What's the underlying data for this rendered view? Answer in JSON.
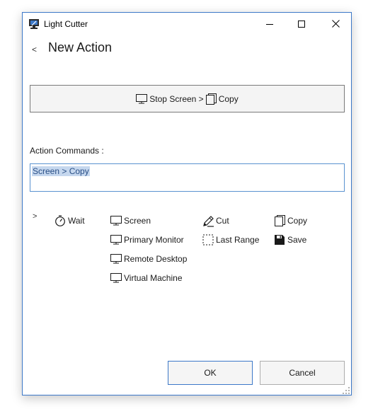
{
  "window": {
    "title": "Light Cutter",
    "controls": {
      "minimize_icon": "minimize-icon",
      "maximize_icon": "maximize-icon",
      "close_icon": "close-icon"
    }
  },
  "page": {
    "back_glyph": "<",
    "heading": "New Action"
  },
  "preview": {
    "segments": [
      {
        "icon": "monitor-icon",
        "text": "Stop Screen >"
      },
      {
        "icon": "copy-icon",
        "text": "Copy"
      }
    ]
  },
  "commands_field": {
    "label": "Action Commands :",
    "value": "Screen > Copy"
  },
  "palette": {
    "toggle_glyph": ">",
    "items": {
      "wait": {
        "icon": "stopwatch-icon",
        "label": "Wait"
      },
      "screen": {
        "icon": "monitor-icon",
        "label": "Screen"
      },
      "primary_monitor": {
        "icon": "monitor-icon",
        "label": "Primary Monitor"
      },
      "remote_desktop": {
        "icon": "monitor-icon",
        "label": "Remote Desktop"
      },
      "virtual_machine": {
        "icon": "monitor-icon",
        "label": "Virtual Machine"
      },
      "cut": {
        "icon": "pen-icon",
        "label": "Cut"
      },
      "last_range": {
        "icon": "dashed-selection-icon",
        "label": "Last Range"
      },
      "copy": {
        "icon": "copy-icon",
        "label": "Copy"
      },
      "save": {
        "icon": "floppy-disk-icon",
        "label": "Save"
      }
    }
  },
  "buttons": {
    "ok": "OK",
    "cancel": "Cancel"
  },
  "colors": {
    "window_border": "#3c78c8",
    "selection_bg": "#c5d7ee",
    "input_border": "#5a92d0"
  }
}
